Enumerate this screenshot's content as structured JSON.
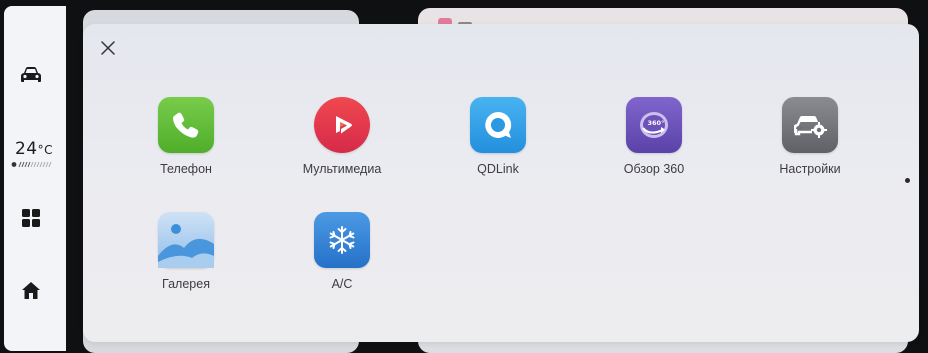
{
  "rail": {
    "temperature": "24",
    "temperature_unit": "°C",
    "icons": [
      "car-icon",
      "apps-grid-icon",
      "home-icon",
      "fan-icon"
    ]
  },
  "panel": {
    "close_icon": "close-icon",
    "apps": [
      {
        "label": "Телефон",
        "icon": "phone-icon",
        "color": "#5aba32"
      },
      {
        "label": "Мультимедиа",
        "icon": "multimedia-icon",
        "color": "#e8344a"
      },
      {
        "label": "QDLink",
        "icon": "qdlink-icon",
        "color": "#2e9fe6"
      },
      {
        "label": "Обзор 360",
        "icon": "view-360-icon",
        "color": "#6a52b8"
      },
      {
        "label": "Настройки",
        "icon": "settings-car-icon",
        "color": "#6e7075"
      },
      {
        "label": "Галерея",
        "icon": "gallery-icon",
        "color": "#3f8fd9"
      },
      {
        "label": "A/C",
        "icon": "ac-snowflake-icon",
        "color": "#2f7fd6"
      }
    ]
  },
  "colors": {
    "panel_bg": "#e9eaef",
    "rail_bg": "#f3f4f7",
    "label_text": "#3d3d40"
  }
}
